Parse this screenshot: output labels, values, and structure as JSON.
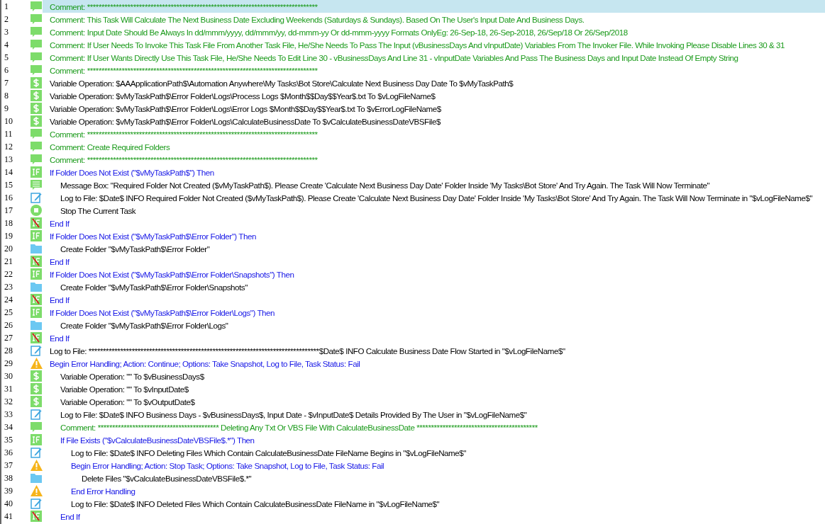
{
  "lines": [
    {
      "number": "1",
      "kind": "comment",
      "selected": true,
      "text": "Comment: ********************************************************************************"
    },
    {
      "number": "2",
      "kind": "comment",
      "selected": false,
      "text": "Comment: This Task Will Calculate The Next Business Date Excluding Weekends (Saturdays & Sundays). Based On The User's Input Date And Business Days."
    },
    {
      "number": "3",
      "kind": "comment",
      "selected": false,
      "text": "Comment: Input Date Should Be Always In dd/mmm/yyyy, dd/mmm/yy, dd-mmm-yy Or dd-mmm-yyyy Formats OnlyEg: 26-Sep-18, 26-Sep-2018, 26/Sep/18 Or 26/Sep/2018"
    },
    {
      "number": "4",
      "kind": "comment",
      "selected": false,
      "text": "Comment: If User Needs To Invoke This Task File From Another Task File, He/She Needs To Pass The Input (vBusinessDays And vInputDate) Variables From The Invoker File. While Invoking Please Disable Lines 30 & 31"
    },
    {
      "number": "5",
      "kind": "comment",
      "selected": false,
      "text": "Comment: If User Wants Directly Use This Task File, He/She Needs To Edit Line 30 - vBusinessDays And Line 31 - vInputDate Variables And Pass The Business Days and Input Date Instead Of Empty String"
    },
    {
      "number": "6",
      "kind": "comment",
      "selected": false,
      "text": "Comment: ********************************************************************************"
    },
    {
      "number": "7",
      "kind": "variable",
      "selected": false,
      "text": "Variable Operation: $AAApplicationPath$\\Automation Anywhere\\My Tasks\\Bot Store\\Calculate Next Business Day Date To $vMyTaskPath$"
    },
    {
      "number": "8",
      "kind": "variable",
      "selected": false,
      "text": "Variable Operation: $vMyTaskPath$\\Error Folder\\Logs\\Process Logs $Month$$Day$$Year$.txt To $vLogFileName$"
    },
    {
      "number": "9",
      "kind": "variable",
      "selected": false,
      "text": "Variable Operation: $vMyTaskPath$\\Error Folder\\Logs\\Error Logs $Month$$Day$$Year$.txt To $vErrorLogFileName$"
    },
    {
      "number": "10",
      "kind": "variable",
      "selected": false,
      "text": "Variable Operation: $vMyTaskPath$\\Error Folder\\Logs\\CalculateBusinessDate To $vCalculateBusinessDateVBSFile$"
    },
    {
      "number": "11",
      "kind": "comment",
      "selected": false,
      "text": "Comment: ********************************************************************************"
    },
    {
      "number": "12",
      "kind": "comment",
      "selected": false,
      "text": "Comment: Create Required Folders"
    },
    {
      "number": "13",
      "kind": "comment",
      "selected": false,
      "text": "Comment: ********************************************************************************"
    },
    {
      "number": "14",
      "kind": "if",
      "selected": false,
      "text": "If Folder Does Not Exist (\"$vMyTaskPath$\")  Then",
      "children": [
        {
          "number": "15",
          "kind": "message",
          "selected": false,
          "text": "Message Box: \"Required Folder Not Created ($vMyTaskPath$). Please Create 'Calculate Next Business Day Date' Folder Inside 'My Tasks\\Bot Store' And Try Again. The Task Will Now Terminate\""
        },
        {
          "number": "16",
          "kind": "log",
          "selected": false,
          "text": "Log to File: $Date$ INFO Required Folder Not Created ($vMyTaskPath$). Please Create 'Calculate Next Business Day Date' Folder Inside 'My Tasks\\Bot Store' And Try Again. The Task Will Now Terminate in \"$vLogFileName$\""
        },
        {
          "number": "17",
          "kind": "stop",
          "selected": false,
          "text": "Stop The Current Task"
        }
      ]
    },
    {
      "number": "18",
      "kind": "endif",
      "selected": false,
      "text": "End If"
    },
    {
      "number": "19",
      "kind": "if",
      "selected": false,
      "text": "If Folder Does Not Exist (\"$vMyTaskPath$\\Error Folder\")  Then",
      "children": [
        {
          "number": "20",
          "kind": "folder",
          "selected": false,
          "text": "Create Folder \"$vMyTaskPath$\\Error Folder\""
        }
      ]
    },
    {
      "number": "21",
      "kind": "endif",
      "selected": false,
      "text": "End If"
    },
    {
      "number": "22",
      "kind": "if",
      "selected": false,
      "text": "If Folder Does Not Exist (\"$vMyTaskPath$\\Error Folder\\Snapshots\")  Then",
      "children": [
        {
          "number": "23",
          "kind": "folder",
          "selected": false,
          "text": "Create Folder \"$vMyTaskPath$\\Error Folder\\Snapshots\""
        }
      ]
    },
    {
      "number": "24",
      "kind": "endif",
      "selected": false,
      "text": "End If"
    },
    {
      "number": "25",
      "kind": "if",
      "selected": false,
      "text": "If Folder Does Not Exist (\"$vMyTaskPath$\\Error Folder\\Logs\")  Then",
      "children": [
        {
          "number": "26",
          "kind": "folder",
          "selected": false,
          "text": "Create Folder \"$vMyTaskPath$\\Error Folder\\Logs\""
        }
      ]
    },
    {
      "number": "27",
      "kind": "endif",
      "selected": false,
      "text": "End If"
    },
    {
      "number": "28",
      "kind": "log",
      "selected": false,
      "text": "Log to File: ********************************************************************************$Date$ INFO Calculate Business Date Flow Started in \"$vLogFileName$\""
    },
    {
      "number": "29",
      "kind": "error",
      "selected": false,
      "text": "Begin Error Handling; Action: Continue; Options: Take Snapshot, Log to File,  Task Status: Fail",
      "children": [
        {
          "number": "30",
          "kind": "variable",
          "selected": false,
          "text": "Variable Operation: \"\" To $vBusinessDays$"
        },
        {
          "number": "31",
          "kind": "variable",
          "selected": false,
          "text": "Variable Operation: \"\" To $vInputDate$"
        },
        {
          "number": "32",
          "kind": "variable",
          "selected": false,
          "text": "Variable Operation: \"\" To $vOutputDate$"
        },
        {
          "number": "33",
          "kind": "log",
          "selected": false,
          "text": "Log to File: $Date$ INFO Business Days - $vBusinessDays$, Input Date - $vInputDate$ Details Provided By The User in \"$vLogFileName$\""
        },
        {
          "number": "34",
          "kind": "comment",
          "selected": false,
          "text": "Comment: ****************************************** Deleting Any Txt Or VBS File With CalculateBusinessDate ******************************************"
        },
        {
          "number": "35",
          "kind": "if",
          "selected": false,
          "text": "If File Exists (\"$vCalculateBusinessDateVBSFile$.*\")  Then",
          "children": [
            {
              "number": "36",
              "kind": "log",
              "selected": false,
              "text": "Log to File: $Date$ INFO Deleting Files Which Contain CalculateBusinessDate FileName Begins in \"$vLogFileName$\""
            },
            {
              "number": "37",
              "kind": "error",
              "selected": false,
              "text": "Begin Error Handling; Action: Stop Task; Options: Take Snapshot, Log to File,  Task Status: Fail",
              "children": [
                {
                  "number": "38",
                  "kind": "folder",
                  "selected": false,
                  "text": "Delete Files \"$vCalculateBusinessDateVBSFile$.*\""
                }
              ]
            },
            {
              "number": "39",
              "kind": "error",
              "selected": false,
              "text": "End Error Handling"
            },
            {
              "number": "40",
              "kind": "log",
              "selected": false,
              "text": "Log to File: $Date$ INFO Deleted Files Which Contain CalculateBusinessDate FileName in \"$vLogFileName$\""
            }
          ]
        },
        {
          "number": "41",
          "kind": "endif",
          "selected": false,
          "text": "End If"
        }
      ]
    }
  ]
}
